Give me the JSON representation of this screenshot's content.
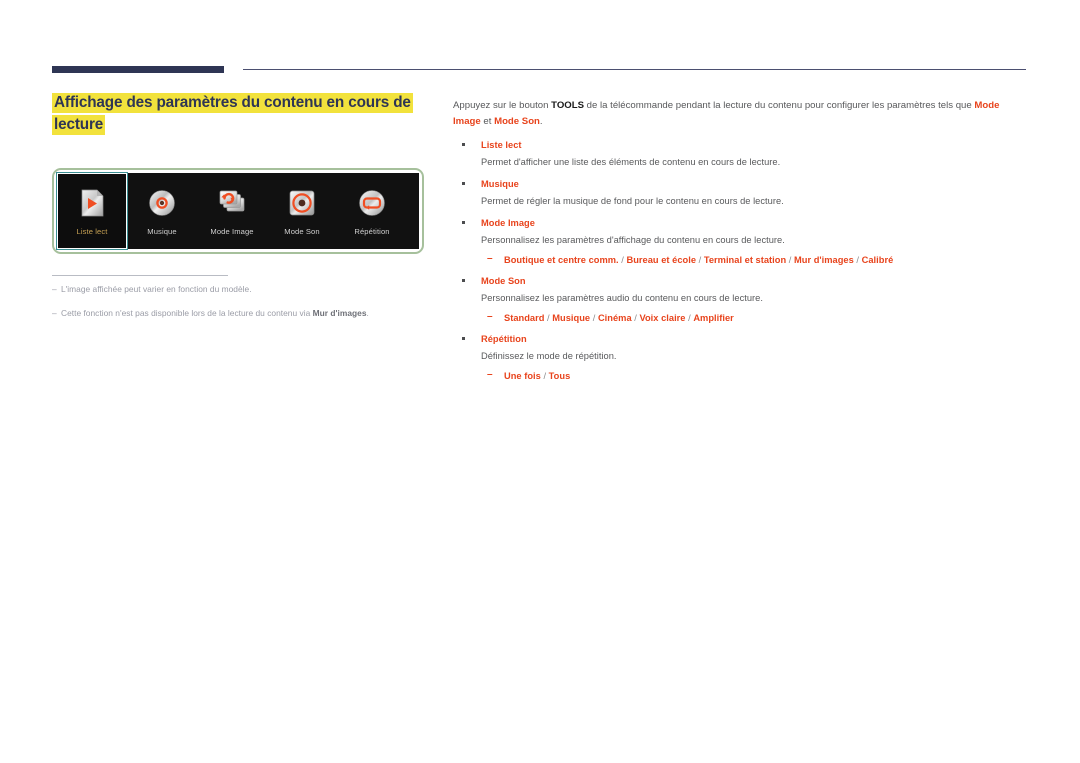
{
  "page": {
    "title_line1": "Affichage des paramètres du contenu en cours de",
    "title_line2": "lecture",
    "title_highlight_color": "#f2e23c",
    "title_text_color": "#2e3554",
    "accent_color": "#e8441d",
    "rule_color": "#2e3554",
    "panel_border_color": "#a6c09c"
  },
  "device_screen": {
    "items": [
      {
        "label": "Liste lect",
        "icon": "playlist-file-icon",
        "selected": true
      },
      {
        "label": "Musique",
        "icon": "music-disc-icon",
        "selected": false
      },
      {
        "label": "Mode Image",
        "icon": "picture-mode-refresh-icon",
        "selected": false
      },
      {
        "label": "Mode Son",
        "icon": "sound-mode-speaker-icon",
        "selected": false
      },
      {
        "label": "Répétition",
        "icon": "repeat-loop-icon",
        "selected": false
      }
    ]
  },
  "footnotes": [
    {
      "dash": "–",
      "text_before": "L'image affichée peut varier en fonction du modèle.",
      "bold": "",
      "text_after": ""
    },
    {
      "dash": "–",
      "text_before": "Cette fonction n'est pas disponible lors de la lecture du contenu via ",
      "bold": "Mur d'images",
      "text_after": "."
    }
  ],
  "content": {
    "intro": {
      "part1": "Appuyez sur le bouton ",
      "tools": "TOOLS",
      "part2": " de la télécommande pendant la lecture du contenu pour configurer les paramètres tels que ",
      "kw1": "Mode Image",
      "part3": " et ",
      "kw2": "Mode Son",
      "part4": "."
    },
    "bullets": [
      {
        "title": "Liste lect",
        "desc": "Permet d'afficher une liste des éléments de contenu en cours de lecture.",
        "options": []
      },
      {
        "title": "Musique",
        "desc": "Permet de régler la musique de fond pour le contenu en cours de lecture.",
        "options": []
      },
      {
        "title": "Mode Image",
        "desc": "Personnalisez les paramètres d'affichage du contenu en cours de lecture.",
        "options": [
          "Boutique et centre comm.",
          "Bureau et école",
          "Terminal et station",
          "Mur d'images",
          "Calibré"
        ]
      },
      {
        "title": "Mode Son",
        "desc": "Personnalisez les paramètres audio du contenu en cours de lecture.",
        "options": [
          "Standard",
          "Musique",
          "Cinéma",
          "Voix claire",
          "Amplifier"
        ]
      },
      {
        "title": "Répétition",
        "desc": "Définissez le mode de répétition.",
        "options": [
          "Une fois",
          "Tous"
        ]
      }
    ]
  }
}
